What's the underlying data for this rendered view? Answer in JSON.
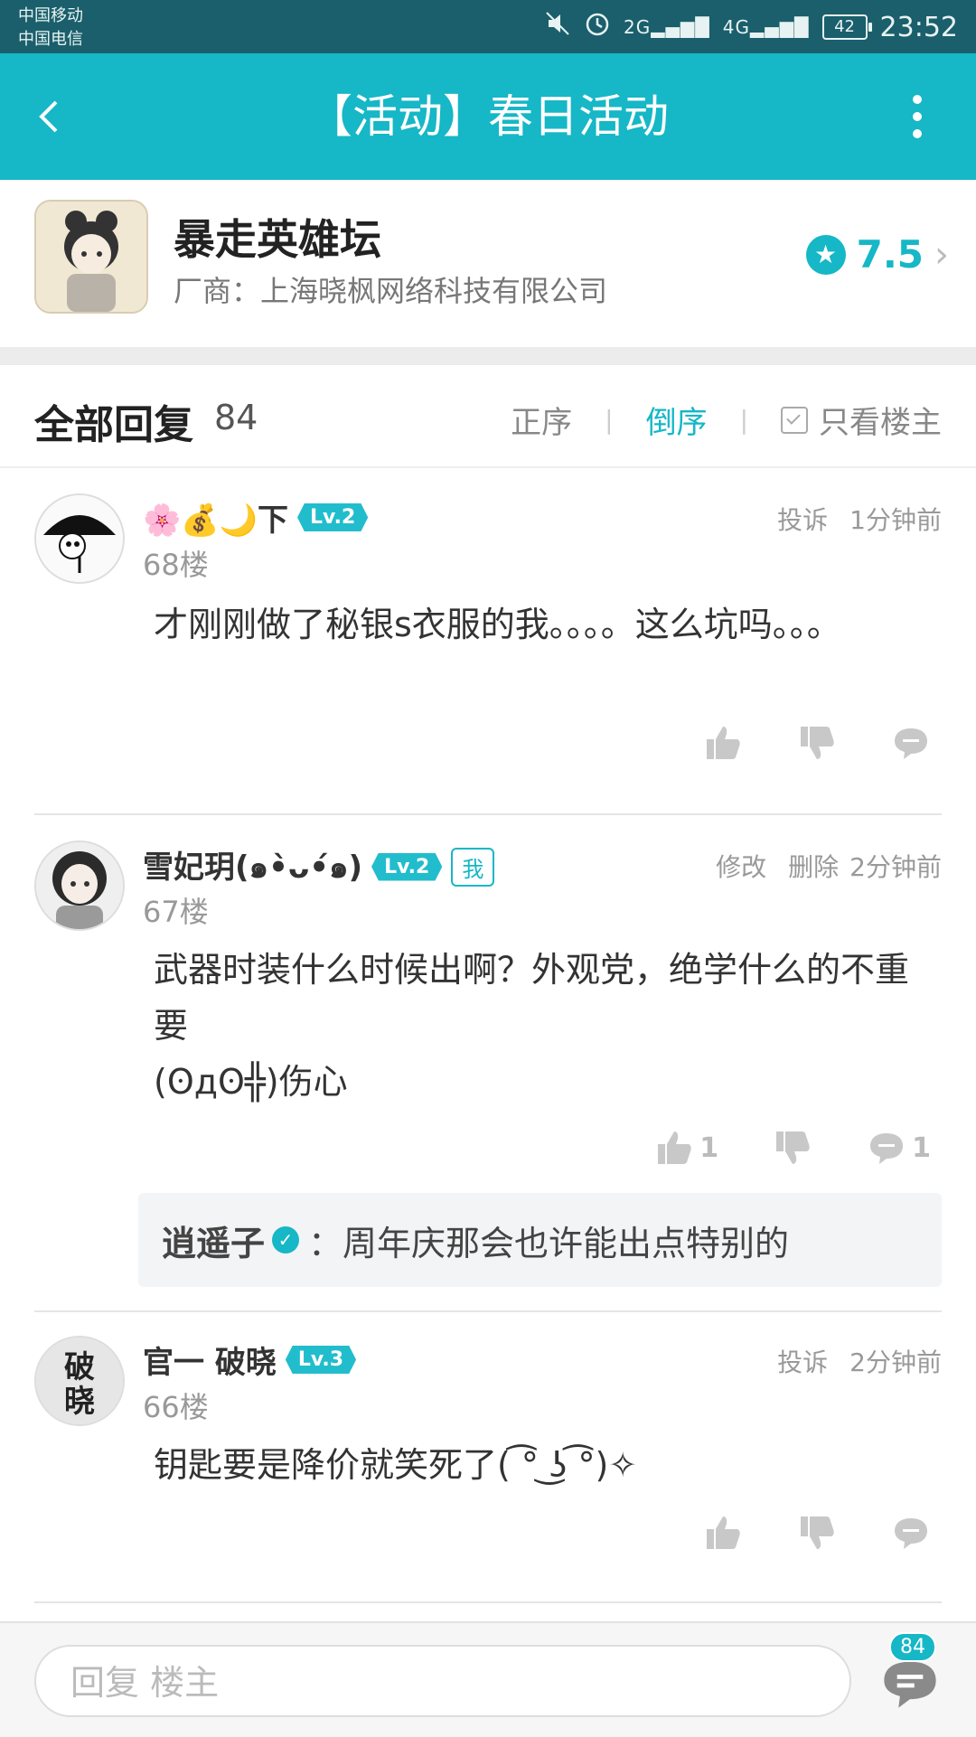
{
  "status_bar": {
    "carrier1": "中国移动",
    "carrier2": "中国电信",
    "network1": "2G",
    "network2": "4G",
    "battery": "42",
    "time": "23:52"
  },
  "header": {
    "title": "【活动】春日活动"
  },
  "game": {
    "name": "暴走英雄坛",
    "vendor": "厂商：上海晓枫网络科技有限公司",
    "rating": "7.5"
  },
  "replies": {
    "title": "全部回复",
    "count": "84",
    "sort_asc": "正序",
    "sort_desc": "倒序",
    "only_op": "只看楼主"
  },
  "comments": [
    {
      "user": "🌸💰🌙下",
      "level": "Lv.2",
      "floor": "68楼",
      "meta_action": "投诉",
      "time": "1分钟前",
      "text": "才刚刚做了秘银s衣服的我。。。。这么坑吗。。。",
      "likes": "",
      "comments": ""
    },
    {
      "user": "雪妃玥(๑•̀ᴗ•́๑)",
      "level": "Lv.2",
      "me_badge": "我",
      "floor": "67楼",
      "meta_edit": "修改",
      "meta_delete": "删除",
      "time": "2分钟前",
      "text": "武器时装什么时候出啊？外观党，绝学什么的不重要\n(ʘдʘ╬)伤心",
      "likes": "1",
      "comments": "1",
      "sub_reply": {
        "author": "逍遥子",
        "text": "：周年庆那会也许能出点特别的"
      }
    },
    {
      "user": "官一 破晓",
      "level": "Lv.3",
      "floor": "66楼",
      "meta_action": "投诉",
      "time": "2分钟前",
      "text": "钥匙要是降价就笑死了( ͡° ͜ʖ ͡°)✧",
      "likes": "",
      "comments": ""
    }
  ],
  "bottom_bar": {
    "placeholder": "回复  楼主",
    "reply_count": "84"
  },
  "colors": {
    "accent": "#16b7c6",
    "status_bar": "#1a5f6b"
  }
}
